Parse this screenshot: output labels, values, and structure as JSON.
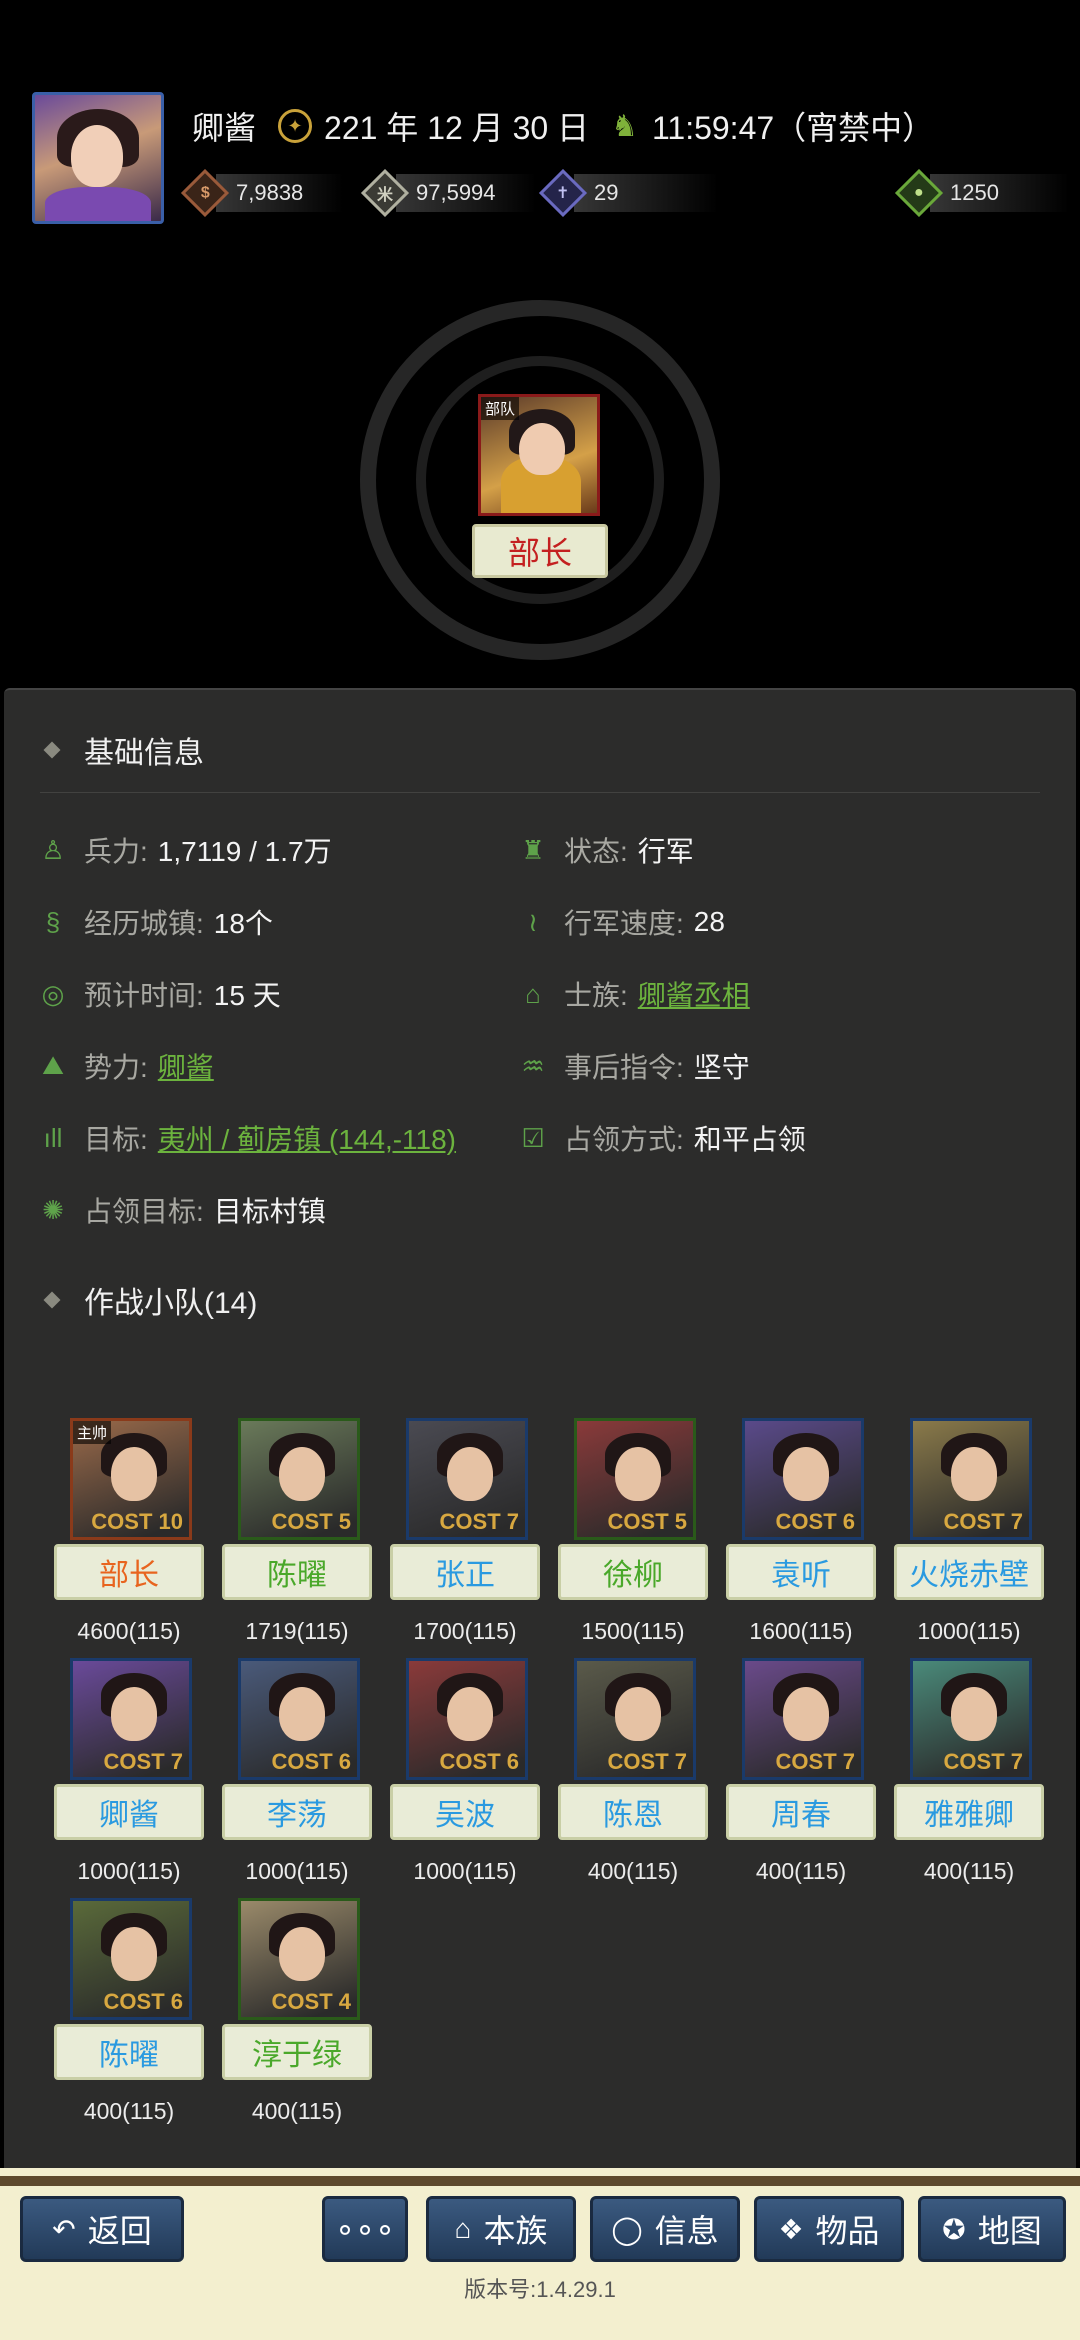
{
  "header": {
    "player_name": "卿酱",
    "date": "221 年 12 月 30 日",
    "time": "11:59:47（宵禁中）",
    "resources": [
      {
        "icon": "coin-icon",
        "value": "7,9838"
      },
      {
        "icon": "grain-icon",
        "value": "97,5994"
      },
      {
        "icon": "person-icon",
        "value": "29"
      },
      {
        "icon": "money-bag-icon",
        "value": "1250"
      }
    ]
  },
  "leader": {
    "tag": "部队",
    "label": "部长"
  },
  "basic_info": {
    "title": "基础信息",
    "troops_label": "兵力:",
    "troops_value": "1,7119 / 1.7万",
    "status_label": "状态:",
    "status_value": "行军",
    "cities_label": "经历城镇:",
    "cities_value": "18个",
    "speed_label": "行军速度:",
    "speed_value": "28",
    "eta_label": "预计时间:",
    "eta_value": "15 天",
    "clan_label": "士族:",
    "clan_value": "卿酱丞相",
    "faction_label": "势力:",
    "faction_value": "卿酱",
    "after_label": "事后指令:",
    "after_value": "坚守",
    "target_label": "目标:",
    "target_value": "夷州 / 蓟房镇 (144,-118)",
    "occupy_mode_label": "占领方式:",
    "occupy_mode_value": "和平占领",
    "occupy_target_label": "占领目标:",
    "occupy_target_value": "目标村镇"
  },
  "squad": {
    "title": "作战小队(14)",
    "members": [
      {
        "name": "部长",
        "troops": "4600(115)",
        "cost": "COST 10",
        "tag": "主帅",
        "name_color": "#e8641e",
        "frame": "#8a3a1a",
        "bg": "#9a6a4a"
      },
      {
        "name": "陈曜",
        "troops": "1719(115)",
        "cost": "COST 5",
        "tag": "",
        "name_color": "#4aa82a",
        "frame": "#2a5a1a",
        "bg": "#6a7a5a"
      },
      {
        "name": "张正",
        "troops": "1700(115)",
        "cost": "COST 7",
        "tag": "",
        "name_color": "#2a9ae0",
        "frame": "#1a3a6a",
        "bg": "#4a4a52"
      },
      {
        "name": "徐柳",
        "troops": "1500(115)",
        "cost": "COST 5",
        "tag": "",
        "name_color": "#4aa82a",
        "frame": "#2a5a1a",
        "bg": "#8a3a3a"
      },
      {
        "name": "袁听",
        "troops": "1600(115)",
        "cost": "COST 6",
        "tag": "",
        "name_color": "#2a9ae0",
        "frame": "#1a3a6a",
        "bg": "#5a4a8a"
      },
      {
        "name": "火烧赤壁",
        "troops": "1000(115)",
        "cost": "COST 7",
        "tag": "",
        "name_color": "#2a9ae0",
        "frame": "#1a3a6a",
        "bg": "#8a7a4a"
      },
      {
        "name": "卿酱",
        "troops": "1000(115)",
        "cost": "COST 7",
        "tag": "",
        "name_color": "#2a9ae0",
        "frame": "#1a3a6a",
        "bg": "#6a4a9a"
      },
      {
        "name": "李荡",
        "troops": "1000(115)",
        "cost": "COST 6",
        "tag": "",
        "name_color": "#2a9ae0",
        "frame": "#1a3a6a",
        "bg": "#4a5a7a"
      },
      {
        "name": "吴波",
        "troops": "1000(115)",
        "cost": "COST 6",
        "tag": "",
        "name_color": "#2a9ae0",
        "frame": "#1a3a6a",
        "bg": "#8a3a3a"
      },
      {
        "name": "陈恩",
        "troops": "400(115)",
        "cost": "COST 7",
        "tag": "",
        "name_color": "#2a9ae0",
        "frame": "#1a3a6a",
        "bg": "#5a5a4a"
      },
      {
        "name": "周春",
        "troops": "400(115)",
        "cost": "COST 7",
        "tag": "",
        "name_color": "#2a9ae0",
        "frame": "#1a3a6a",
        "bg": "#6a4a8a"
      },
      {
        "name": "雅雅卿",
        "troops": "400(115)",
        "cost": "COST 7",
        "tag": "",
        "name_color": "#2a9ae0",
        "frame": "#1a3a6a",
        "bg": "#4a8a7a"
      },
      {
        "name": "陈曜",
        "troops": "400(115)",
        "cost": "COST 6",
        "tag": "",
        "name_color": "#2a9ae0",
        "frame": "#1a3a6a",
        "bg": "#5a6a3a"
      },
      {
        "name": "淳于绿",
        "troops": "400(115)",
        "cost": "COST 4",
        "tag": "",
        "name_color": "#4aa82a",
        "frame": "#2a5a1a",
        "bg": "#9a8a6a"
      }
    ]
  },
  "bottom_bar": {
    "back": "返回",
    "more": "∘∘∘",
    "clan": "本族",
    "info": "信息",
    "items": "物品",
    "map": "地图",
    "version": "版本号:1.4.29.1"
  }
}
